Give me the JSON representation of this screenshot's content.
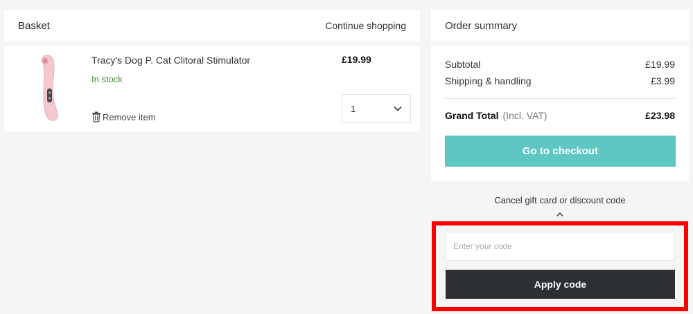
{
  "basket": {
    "title": "Basket",
    "continue_label": "Continue shopping",
    "item": {
      "name": "Tracy's Dog P. Cat Clitoral Stimulator",
      "stock": "In stock",
      "remove_label": "Remove item",
      "price": "£19.99",
      "quantity": "1"
    }
  },
  "summary": {
    "title": "Order summary",
    "subtotal_label": "Subtotal",
    "subtotal_value": "£19.99",
    "shipping_label": "Shipping & handling",
    "shipping_value": "£3.99",
    "grand_total_label": "Grand Total",
    "vat_note": "(Incl. VAT)",
    "grand_total_value": "£23.98",
    "checkout_label": "Go to checkout"
  },
  "discount": {
    "toggle_label": "Cancel gift card or discount code",
    "input_placeholder": "Enter your code",
    "apply_label": "Apply code"
  },
  "colors": {
    "accent": "#5ec7c4",
    "apply_button": "#2d3032",
    "stock_green": "#4a8a3a",
    "highlight": "#ff0000"
  },
  "icons": {
    "remove": "trash-icon",
    "quantity": "chevron-down-icon",
    "discount_toggle": "chevron-up-icon"
  }
}
